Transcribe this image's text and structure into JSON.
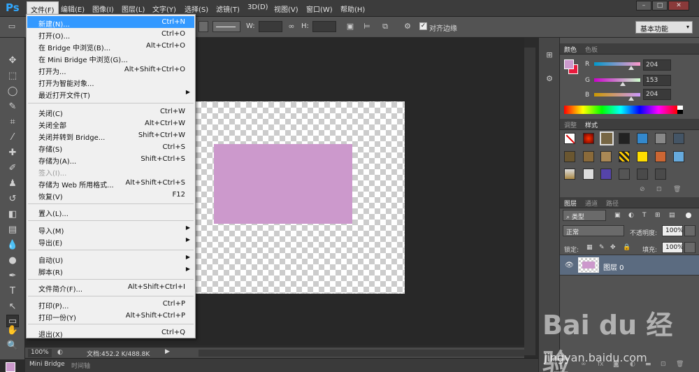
{
  "app": {
    "logo": "Ps"
  },
  "menubar": {
    "items": [
      "文件(F)",
      "编辑(E)",
      "图像(I)",
      "图层(L)",
      "文字(Y)",
      "选择(S)",
      "滤镜(T)",
      "3D(D)",
      "视图(V)",
      "窗口(W)",
      "帮助(H)"
    ],
    "active_index": 0
  },
  "window_controls": {
    "minimize": "–",
    "restore": "□",
    "close": "✕"
  },
  "options_bar": {
    "w_label": "W:",
    "h_label": "H:",
    "align_edges_label": "对齐边缘",
    "align_edges_checked": true,
    "workspace": "基本功能"
  },
  "file_menu": {
    "items": [
      {
        "label": "新建(N)...",
        "shortcut": "Ctrl+N",
        "highlighted": true
      },
      {
        "label": "打开(O)...",
        "shortcut": "Ctrl+O"
      },
      {
        "label": "在 Bridge 中浏览(B)...",
        "shortcut": "Alt+Ctrl+O"
      },
      {
        "label": "在 Mini Bridge 中浏览(G)...",
        "shortcut": ""
      },
      {
        "label": "打开为...",
        "shortcut": "Alt+Shift+Ctrl+O"
      },
      {
        "label": "打开为智能对象...",
        "shortcut": ""
      },
      {
        "label": "最近打开文件(T)",
        "shortcut": "",
        "submenu": true
      },
      {
        "label": "关闭(C)",
        "shortcut": "Ctrl+W"
      },
      {
        "label": "关闭全部",
        "shortcut": "Alt+Ctrl+W"
      },
      {
        "label": "关闭并转到 Bridge...",
        "shortcut": "Shift+Ctrl+W"
      },
      {
        "label": "存储(S)",
        "shortcut": "Ctrl+S"
      },
      {
        "label": "存储为(A)...",
        "shortcut": "Shift+Ctrl+S"
      },
      {
        "label": "签入(I)...",
        "shortcut": "",
        "disabled": true
      },
      {
        "label": "存储为 Web 所用格式...",
        "shortcut": "Alt+Shift+Ctrl+S"
      },
      {
        "label": "恢复(V)",
        "shortcut": "F12"
      },
      {
        "label": "置入(L)...",
        "shortcut": ""
      },
      {
        "label": "导入(M)",
        "shortcut": "",
        "submenu": true
      },
      {
        "label": "导出(E)",
        "shortcut": "",
        "submenu": true
      },
      {
        "label": "自动(U)",
        "shortcut": "",
        "submenu": true
      },
      {
        "label": "脚本(R)",
        "shortcut": "",
        "submenu": true
      },
      {
        "label": "文件简介(F)...",
        "shortcut": "Alt+Shift+Ctrl+I"
      },
      {
        "label": "打印(P)...",
        "shortcut": "Ctrl+P"
      },
      {
        "label": "打印一份(Y)",
        "shortcut": "Alt+Shift+Ctrl+P"
      },
      {
        "label": "退出(X)",
        "shortcut": "Ctrl+Q"
      }
    ]
  },
  "status": {
    "zoom": "100%",
    "doc_info": "文档:452.2 K/488.8K"
  },
  "bottom_tabs": {
    "mini_bridge": "Mini Bridge",
    "timeline": "时间轴"
  },
  "color_panel": {
    "tabs": [
      "颜色",
      "色板"
    ],
    "r_label": "R",
    "g_label": "G",
    "b_label": "B",
    "r": "204",
    "g": "153",
    "b": "204",
    "foreground": "#cc99cc",
    "background": "#e8193c"
  },
  "styles_panel": {
    "tabs": [
      "调整",
      "样式"
    ]
  },
  "layers_panel": {
    "tabs": [
      "图层",
      "通道",
      "路径"
    ],
    "filter_kind": "类型",
    "blend_mode": "正常",
    "opacity_label": "不透明度:",
    "opacity": "100%",
    "lock_label": "锁定:",
    "fill_label": "填充:",
    "fill": "100%",
    "layer_name": "图层 0"
  },
  "watermark": {
    "brand": "Bai du 经验",
    "url": "jingyan.baidu.com"
  }
}
